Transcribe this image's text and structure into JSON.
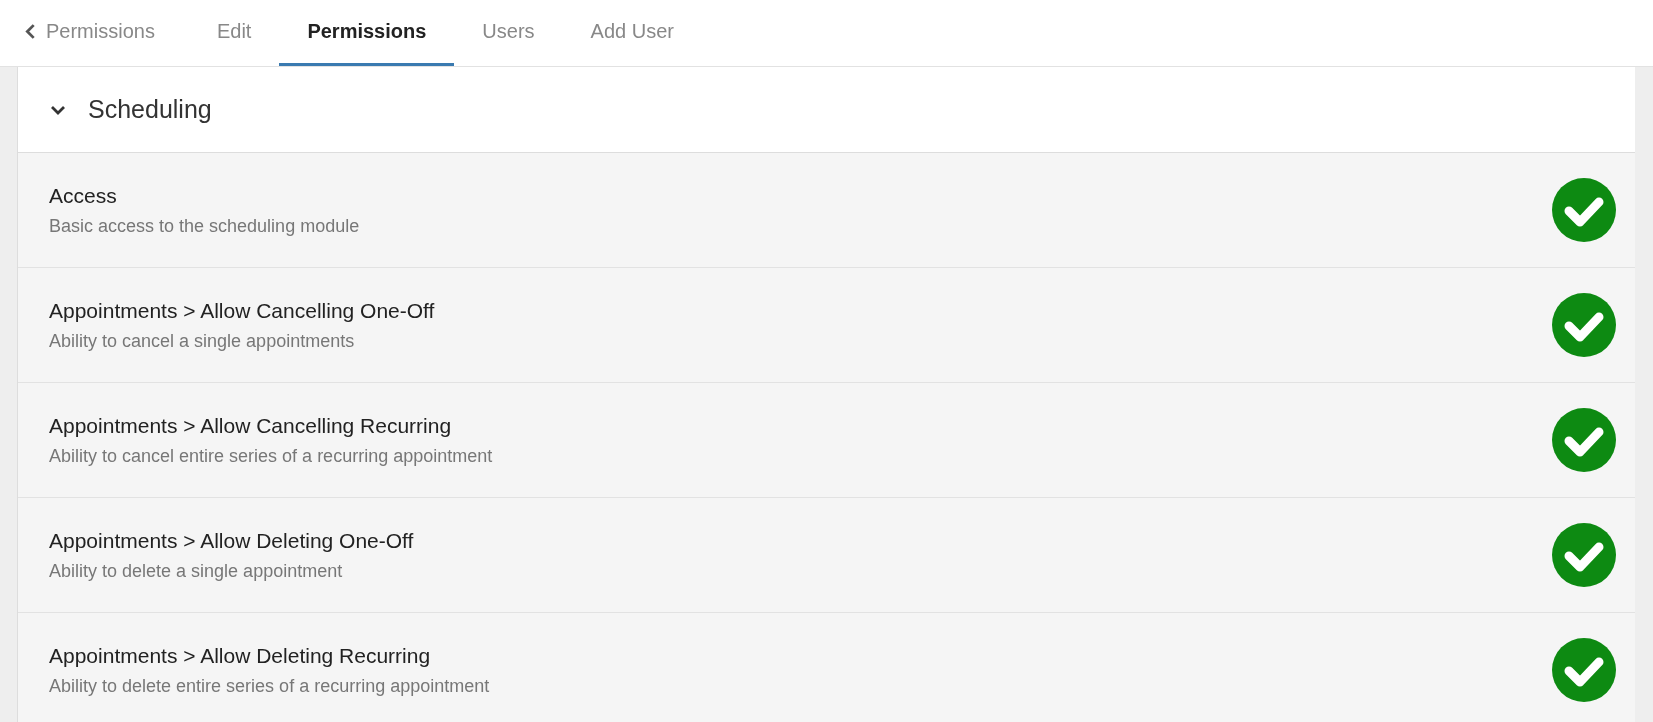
{
  "back_link": {
    "label": "Permissions"
  },
  "tabs": [
    {
      "label": "Edit",
      "selected": false
    },
    {
      "label": "Permissions",
      "selected": true
    },
    {
      "label": "Users",
      "selected": false
    },
    {
      "label": "Add User",
      "selected": false
    }
  ],
  "section": {
    "title": "Scheduling",
    "expanded": true,
    "permissions": [
      {
        "name": "Access",
        "description": "Basic access to the scheduling module",
        "granted": true
      },
      {
        "name": "Appointments > Allow Cancelling One-Off",
        "description": "Ability to cancel a single appointments",
        "granted": true
      },
      {
        "name": "Appointments > Allow Cancelling Recurring",
        "description": "Ability to cancel entire series of a recurring appointment",
        "granted": true
      },
      {
        "name": "Appointments > Allow Deleting One-Off",
        "description": "Ability to delete a single appointment",
        "granted": true
      },
      {
        "name": "Appointments > Allow Deleting Recurring",
        "description": "Ability to delete entire series of a recurring appointment",
        "granted": true
      }
    ]
  }
}
